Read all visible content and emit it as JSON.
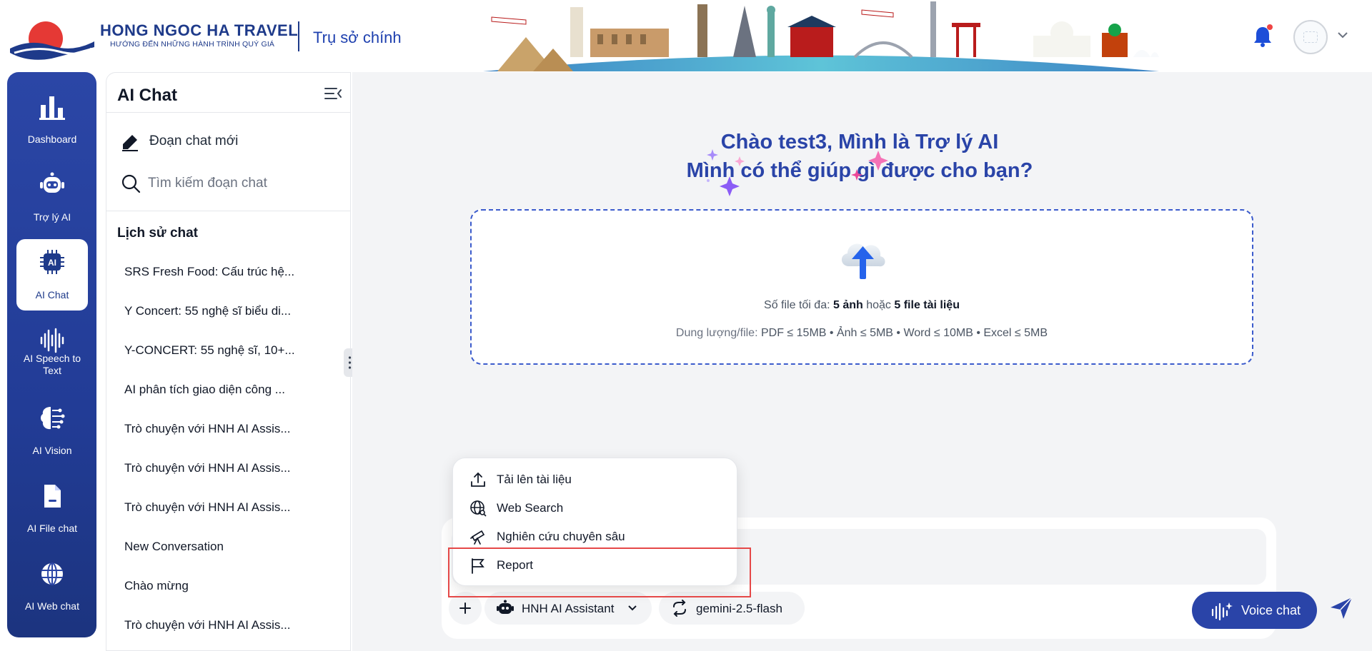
{
  "header": {
    "brand_name": "HONG NGOC HA TRAVEL",
    "brand_slogan": "HƯỚNG ĐẾN NHỮNG HÀNH TRÌNH QUÝ GIÁ",
    "branch": "Trụ sở chính"
  },
  "nav": {
    "items": [
      {
        "label": "Dashboard",
        "icon": "bar-chart-icon"
      },
      {
        "label": "Trợ lý AI",
        "icon": "robot-icon"
      },
      {
        "label": "AI Chat",
        "icon": "ai-chip-icon",
        "active": true
      },
      {
        "label": "AI Speech to Text",
        "icon": "sound-wave-icon"
      },
      {
        "label": "AI Vision",
        "icon": "brain-icon"
      },
      {
        "label": "AI File chat",
        "icon": "file-icon"
      },
      {
        "label": "AI Web chat",
        "icon": "globe-icon"
      }
    ]
  },
  "panel": {
    "title": "AI Chat",
    "new_chat": "Đoạn chat mới",
    "search_placeholder": "Tìm kiếm đoạn chat",
    "history_title": "Lịch sử chat",
    "history": [
      "SRS Fresh Food: Cấu trúc hệ...",
      "Y Concert: 55 nghệ sĩ biểu di...",
      "Y-CONCERT: 55 nghệ sĩ, 10+...",
      "AI phân tích giao diện công ...",
      "Trò chuyện với HNH AI Assis...",
      "Trò chuyện với HNH AI Assis...",
      "Trò chuyện với HNH AI Assis...",
      "New Conversation",
      "Chào mừng",
      "Trò chuyện với HNH AI Assis..."
    ]
  },
  "main": {
    "greeting_line1": "Chào test3, Mình là Trợ lý AI",
    "greeting_line2": "Mình có thể giúp gì được cho bạn?",
    "upload": {
      "limit_prefix": "Số file tối đa: ",
      "limit_images": "5 ảnh",
      "limit_or": " hoặc ",
      "limit_docs": "5 file tài liệu",
      "size_prefix": "Dung lượng/file: ",
      "size_values": "PDF ≤ 15MB • Ảnh ≤ 5MB • Word ≤ 10MB • Excel ≤ 5MB"
    }
  },
  "composer": {
    "assistant": "HNH AI Assistant",
    "model": "gemini-2.5-flash",
    "voice_chat": "Voice chat"
  },
  "menu": {
    "items": [
      {
        "label": "Tải lên tài liệu",
        "icon": "upload-icon"
      },
      {
        "label": "Web Search",
        "icon": "web-search-icon"
      },
      {
        "label": "Nghiên cứu chuyên sâu",
        "icon": "telescope-icon"
      },
      {
        "label": "Report",
        "icon": "flag-icon"
      }
    ]
  },
  "colors": {
    "brand_blue": "#2a44a8",
    "nav_gradient_top": "#2b46a6",
    "highlight_red": "#e54848"
  }
}
